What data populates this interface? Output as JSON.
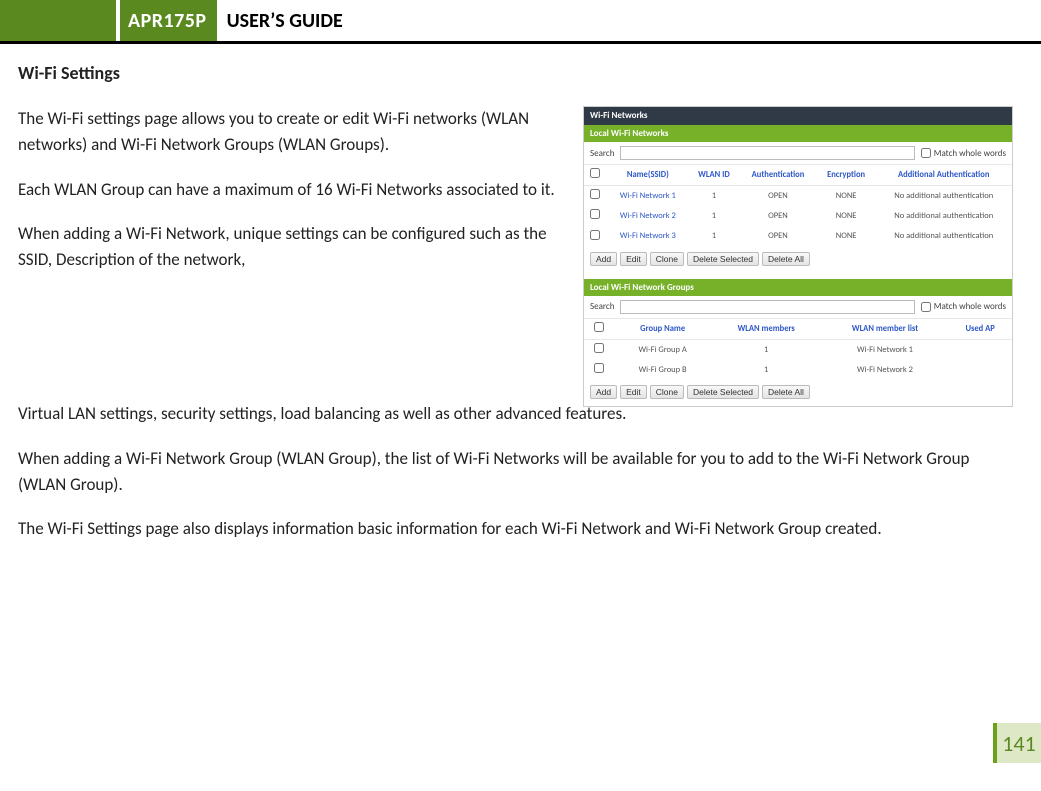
{
  "header": {
    "product": "APR175P",
    "title": "USER’S GUIDE"
  },
  "section_title": "Wi-Fi Settings",
  "paragraphs": {
    "p1": "The Wi-Fi settings page allows you to create or edit Wi-Fi networks (WLAN networks) and Wi-Fi Network Groups (WLAN Groups).",
    "p2": "Each WLAN Group can have a maximum of 16 Wi-Fi Networks associated to it.",
    "p3_lead": "When adding a Wi-Fi Network, unique settings can be configured such as the SSID, Description of the network,",
    "p3_full": "Virtual LAN settings, security settings, load balancing as well as other advanced features.",
    "p4": "When adding a Wi-Fi Network Group (WLAN Group), the list of Wi-Fi Networks will be available for you to add to the Wi-Fi Network Group (WLAN Group).",
    "p5": "The Wi-Fi Settings page also displays information basic information for each Wi-Fi Network and Wi-Fi Network Group created."
  },
  "mock": {
    "top_banner": "Wi-Fi Networks",
    "local_networks_banner": "Local Wi-Fi Networks",
    "search_label": "Search",
    "match_whole_words": "Match whole words",
    "net_headers": {
      "name": "Name(SSID)",
      "wlanid": "WLAN ID",
      "auth": "Authentication",
      "encr": "Encryption",
      "addl": "Additional Authentication"
    },
    "net_rows": [
      {
        "name": "Wi-Fi Network 1",
        "wlanid": "1",
        "auth": "OPEN",
        "encr": "NONE",
        "addl": "No additional authentication"
      },
      {
        "name": "Wi-Fi Network 2",
        "wlanid": "1",
        "auth": "OPEN",
        "encr": "NONE",
        "addl": "No additional authentication"
      },
      {
        "name": "Wi-Fi Network 3",
        "wlanid": "1",
        "auth": "OPEN",
        "encr": "NONE",
        "addl": "No additional authentication"
      }
    ],
    "groups_banner": "Local Wi-Fi Network Groups",
    "grp_headers": {
      "name": "Group Name",
      "members": "WLAN members",
      "memberlist": "WLAN member list",
      "usedap": "Used AP"
    },
    "grp_rows": [
      {
        "name": "Wi-Fi Group A",
        "members": "1",
        "memberlist": "Wi-Fi Network 1",
        "usedap": ""
      },
      {
        "name": "Wi-Fi Group B",
        "members": "1",
        "memberlist": "Wi-Fi Network 2",
        "usedap": ""
      }
    ],
    "actions": {
      "add": "Add",
      "edit": "Edit",
      "clone": "Clone",
      "delete_selected": "Delete Selected",
      "delete_all": "Delete All"
    }
  },
  "page_number": "141"
}
